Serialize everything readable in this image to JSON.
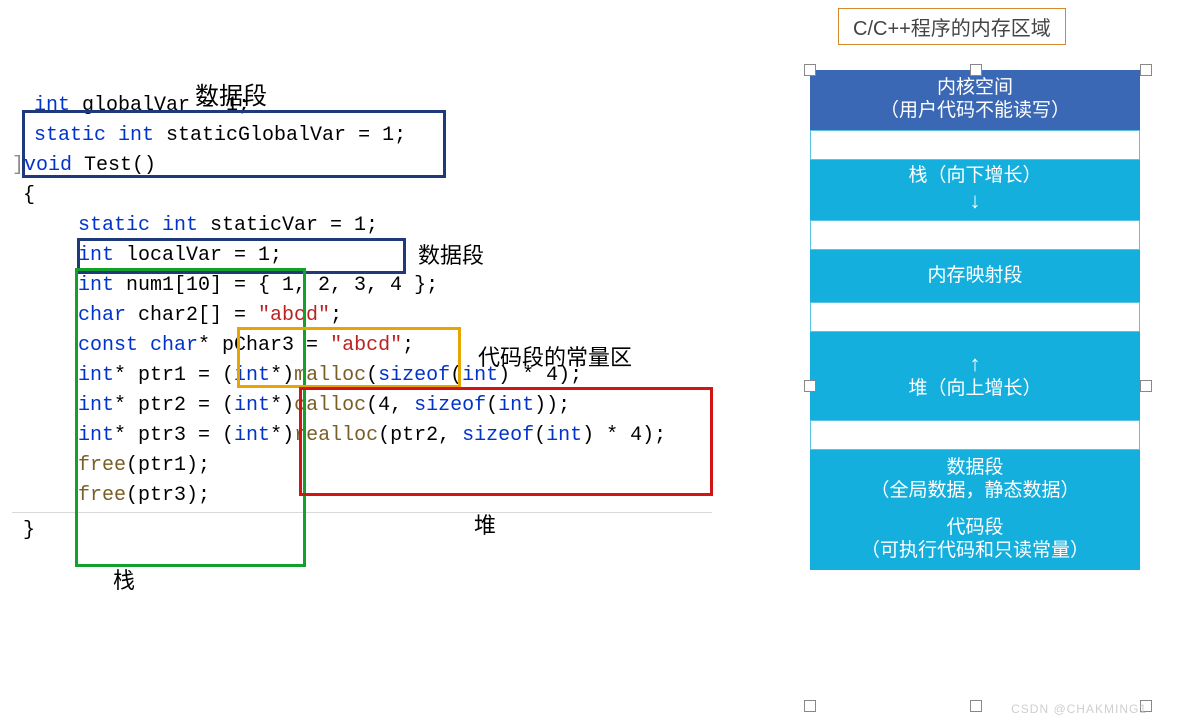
{
  "labels": {
    "dataSegTop": "数据段",
    "dataSegInline": "数据段",
    "constArea": "代码段的常量区",
    "heapLabel": "堆",
    "stackLabel": "栈"
  },
  "code": {
    "l1_kw": "int",
    "l1_b": " globalVar = 1;",
    "l2_kw": "static int",
    "l2_b": " staticGlobalVar = 1;",
    "l3_kw": "void",
    "l3_b": " Test()",
    "l4": "{",
    "l5_kw": "static int",
    "l5_b": " staticVar = 1;",
    "l6_kw": "int",
    "l6_b": " localVar = 1;",
    "l7_kw": "int",
    "l7_b": " num1[10] = { 1, 2, 3, 4 };",
    "l8_kw": "char",
    "l8_b": " char2[] = ",
    "l8_str": "\"abcd\"",
    "l8_c": ";",
    "l9_kw": "const char",
    "l9_b": "* pChar3 = ",
    "l9_str": "\"abcd\"",
    "l9_c": ";",
    "l10_kw": "int",
    "l10_b": "* ptr1 = (",
    "l10_kw2": "int",
    "l10_c": "*)",
    "l10_fn": "malloc",
    "l10_d": "(",
    "l10_kw3": "sizeof",
    "l10_e": "(",
    "l10_kw4": "int",
    "l10_f": ") * 4);",
    "l11_kw": "int",
    "l11_b": "* ptr2 = (",
    "l11_kw2": "int",
    "l11_c": "*)",
    "l11_fn": "calloc",
    "l11_d": "(4, ",
    "l11_kw3": "sizeof",
    "l11_e": "(",
    "l11_kw4": "int",
    "l11_f": "));",
    "l12_kw": "int",
    "l12_b": "* ptr3 = (",
    "l12_kw2": "int",
    "l12_c": "*)",
    "l12_fn": "realloc",
    "l12_d": "(ptr2, ",
    "l12_kw3": "sizeof",
    "l12_e": "(",
    "l12_kw4": "int",
    "l12_f": ") * 4);",
    "l13_fn": "free",
    "l13_b": "(ptr1);",
    "l14_fn": "free",
    "l14_b": "(ptr3);",
    "l15": "}"
  },
  "memTitle": "C/C++程序的内存区域",
  "mem": {
    "kernel_l1": "内核空间",
    "kernel_l2": "（用户代码不能读写）",
    "stack_l1": "栈（向下增长）",
    "stack_arrow": "↓",
    "mmap": "内存映射段",
    "heap_arrow": "↑",
    "heap_l1": "堆（向上增长）",
    "data_l1": "数据段",
    "data_l2": "（全局数据，静态数据）",
    "code_l1": "代码段",
    "code_l2": "（可执行代码和只读常量）"
  },
  "watermark": "CSDN @CHAKMING1"
}
